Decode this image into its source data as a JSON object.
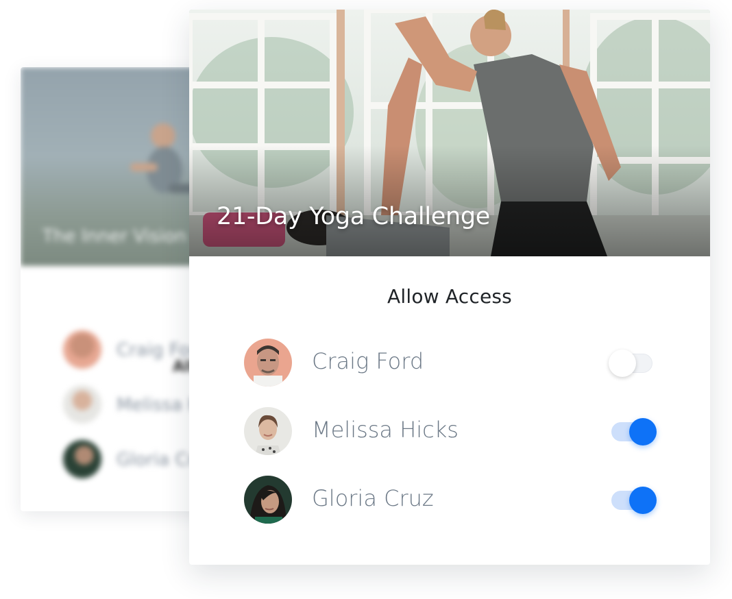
{
  "background_card": {
    "title": "The Inner Vision",
    "heading": "Allow Access",
    "users": [
      {
        "name": "Craig Ford"
      },
      {
        "name": "Melissa Hicks"
      },
      {
        "name": "Gloria Cruz"
      }
    ]
  },
  "card": {
    "title": "21-Day Yoga Challenge",
    "heading": "Allow Access",
    "users": [
      {
        "name": "Craig Ford",
        "access": false
      },
      {
        "name": "Melissa Hicks",
        "access": true
      },
      {
        "name": "Gloria Cruz",
        "access": true
      }
    ]
  },
  "colors": {
    "accent": "#0e72f7",
    "accent_track": "#cddffb",
    "name_text": "#6a7785",
    "heading_text": "#1f2327"
  }
}
